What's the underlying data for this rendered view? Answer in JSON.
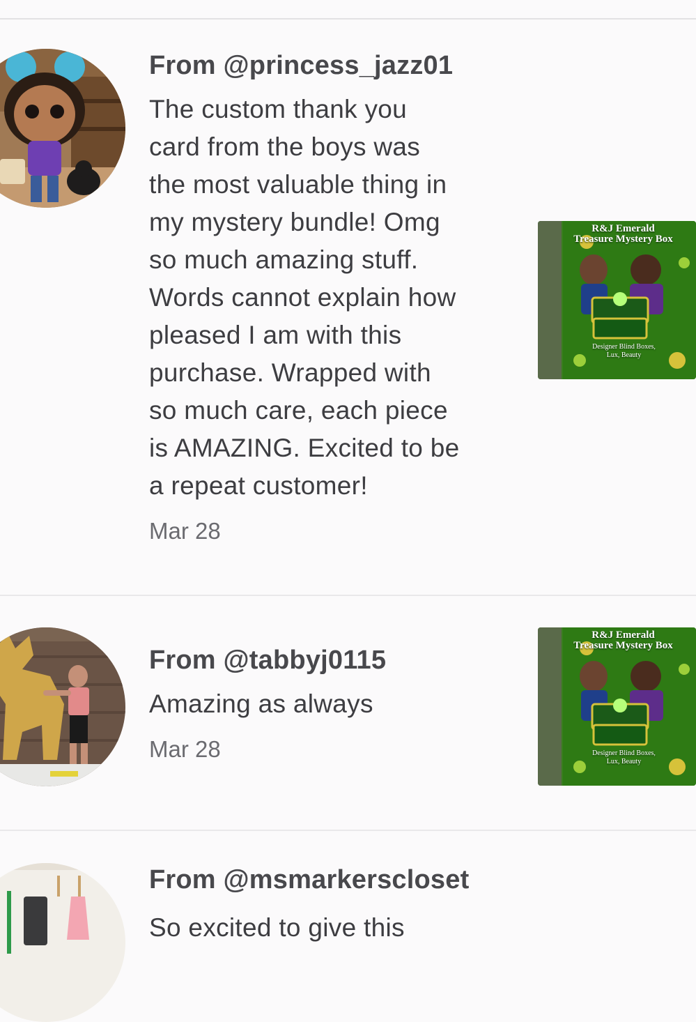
{
  "reviews": [
    {
      "from": "From @princess_jazz01",
      "message": "The custom thank you\ncard from the boys was\nthe most valuable thing in\nmy mystery bundle! Omg\nso much amazing stuff.\nWords cannot explain how\npleased I am with this\npurchase. Wrapped with\nso much care, each piece\nis AMAZING. Excited to be\na repeat customer!",
      "date": "Mar 28",
      "product": {
        "title_line1": "R&J Emerald",
        "title_line2": "Treasure Mystery Box",
        "subtitle_line1": "Designer Blind Boxes,",
        "subtitle_line2": "Lux, Beauty"
      }
    },
    {
      "from": "From @tabbyj0115",
      "message": "Amazing as always",
      "date": "Mar 28",
      "product": {
        "title_line1": "R&J Emerald",
        "title_line2": "Treasure Mystery Box",
        "subtitle_line1": "Designer Blind Boxes,",
        "subtitle_line2": "Lux, Beauty"
      }
    },
    {
      "from": "From @msmarkerscloset",
      "message": "So excited to give this"
    }
  ],
  "icons": {
    "avatar_1": "funko-figure-avatar",
    "avatar_2": "moose-cutout-avatar",
    "avatar_3": "clothing-rack-avatar",
    "product": "product-thumbnail"
  },
  "colors": {
    "background": "#fbfafb",
    "divider": "#e9e8ea",
    "text": "#3d3d41",
    "secondary_text": "#6b6b70",
    "thumbnail_green": "#2f7a16"
  }
}
